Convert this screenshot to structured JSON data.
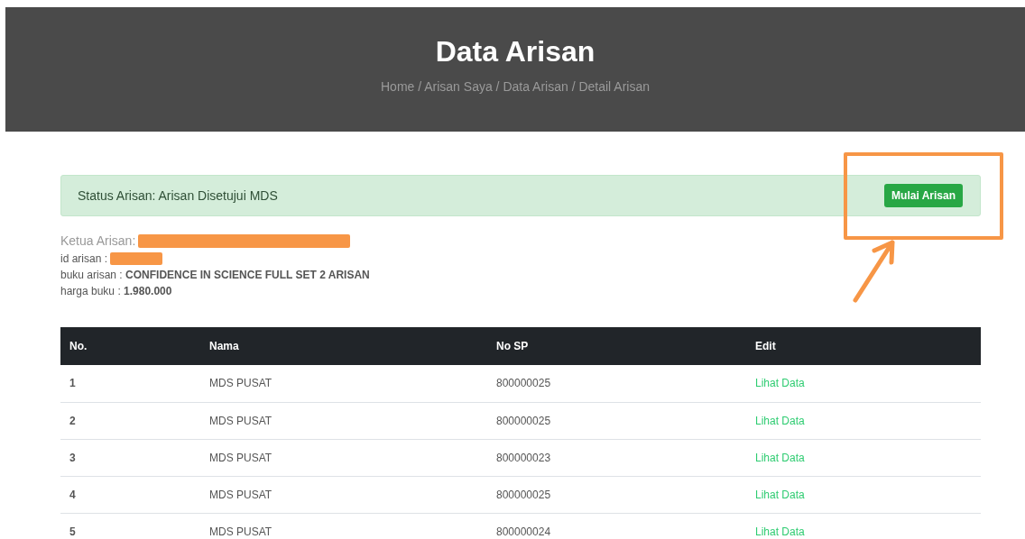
{
  "header": {
    "title": "Data Arisan",
    "breadcrumb": "Home / Arisan Saya / Data Arisan / Detail Arisan"
  },
  "status": {
    "text": "Status Arisan: Arisan Disetujui MDS",
    "button": "Mulai Arisan"
  },
  "info": {
    "ketua_label": "Ketua Arisan:",
    "id_label": "id arisan :",
    "buku": "buku arisan : **CONFIDENCE IN SCIENCE FULL SET 2 ARISAN**",
    "harga": "harga buku : **1.980.000**"
  },
  "table": {
    "columns": [
      "No.",
      "Nama",
      "No SP",
      "Edit"
    ],
    "rows": [
      {
        "no": "1",
        "nama": "MDS PUSAT",
        "no_sp": "800000025",
        "edit": "Lihat Data"
      },
      {
        "no": "2",
        "nama": "MDS PUSAT",
        "no_sp": "800000025",
        "edit": "Lihat Data"
      },
      {
        "no": "3",
        "nama": "MDS PUSAT",
        "no_sp": "800000023",
        "edit": "Lihat Data"
      },
      {
        "no": "4",
        "nama": "MDS PUSAT",
        "no_sp": "800000025",
        "edit": "Lihat Data"
      },
      {
        "no": "5",
        "nama": "MDS PUSAT",
        "no_sp": "800000024",
        "edit": "Lihat Data"
      }
    ]
  }
}
